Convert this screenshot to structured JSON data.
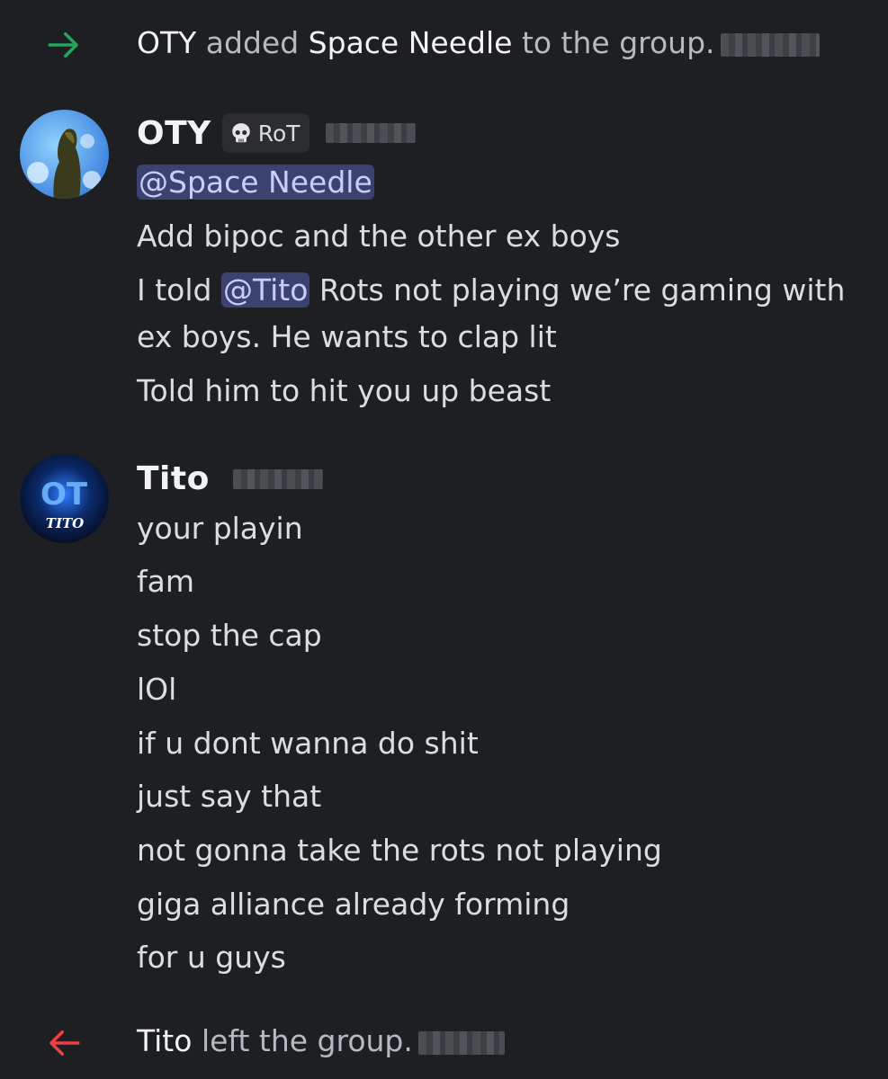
{
  "system_messages": {
    "added": {
      "actor": "OTY",
      "verb": "added",
      "target": "Space Needle",
      "rest": "to the group.",
      "icon": "arrow-right-icon",
      "icon_color": "#23a55a"
    },
    "left": {
      "actor": "Tito",
      "rest": "left the group.",
      "icon": "arrow-left-icon",
      "icon_color": "#f23f43"
    }
  },
  "messages": [
    {
      "author": "OTY",
      "role_tag": "RoT",
      "role_icon": "skull-icon",
      "lines": {
        "l0_mention": "@Space Needle",
        "l1": "Add bipoc and the other ex boys",
        "l2_before": "I told ",
        "l2_mention": "@Tito",
        "l2_after": " Rots not playing we’re gaming with",
        "l3": "ex boys. He wants to clap lit",
        "l4": "Told him to hit you up beast"
      }
    },
    {
      "author": "Tito",
      "avatar_text": "TITO",
      "lines": [
        "your playin",
        "fam",
        "stop the cap",
        "lOl",
        "if u dont wanna do shit",
        "just say that",
        "not gonna take the rots not playing",
        "giga alliance already forming",
        "for u guys"
      ]
    }
  ],
  "colors": {
    "background": "#1e1f22",
    "mention_bg": "#3c4270",
    "mention_fg": "#c9cdfb"
  }
}
